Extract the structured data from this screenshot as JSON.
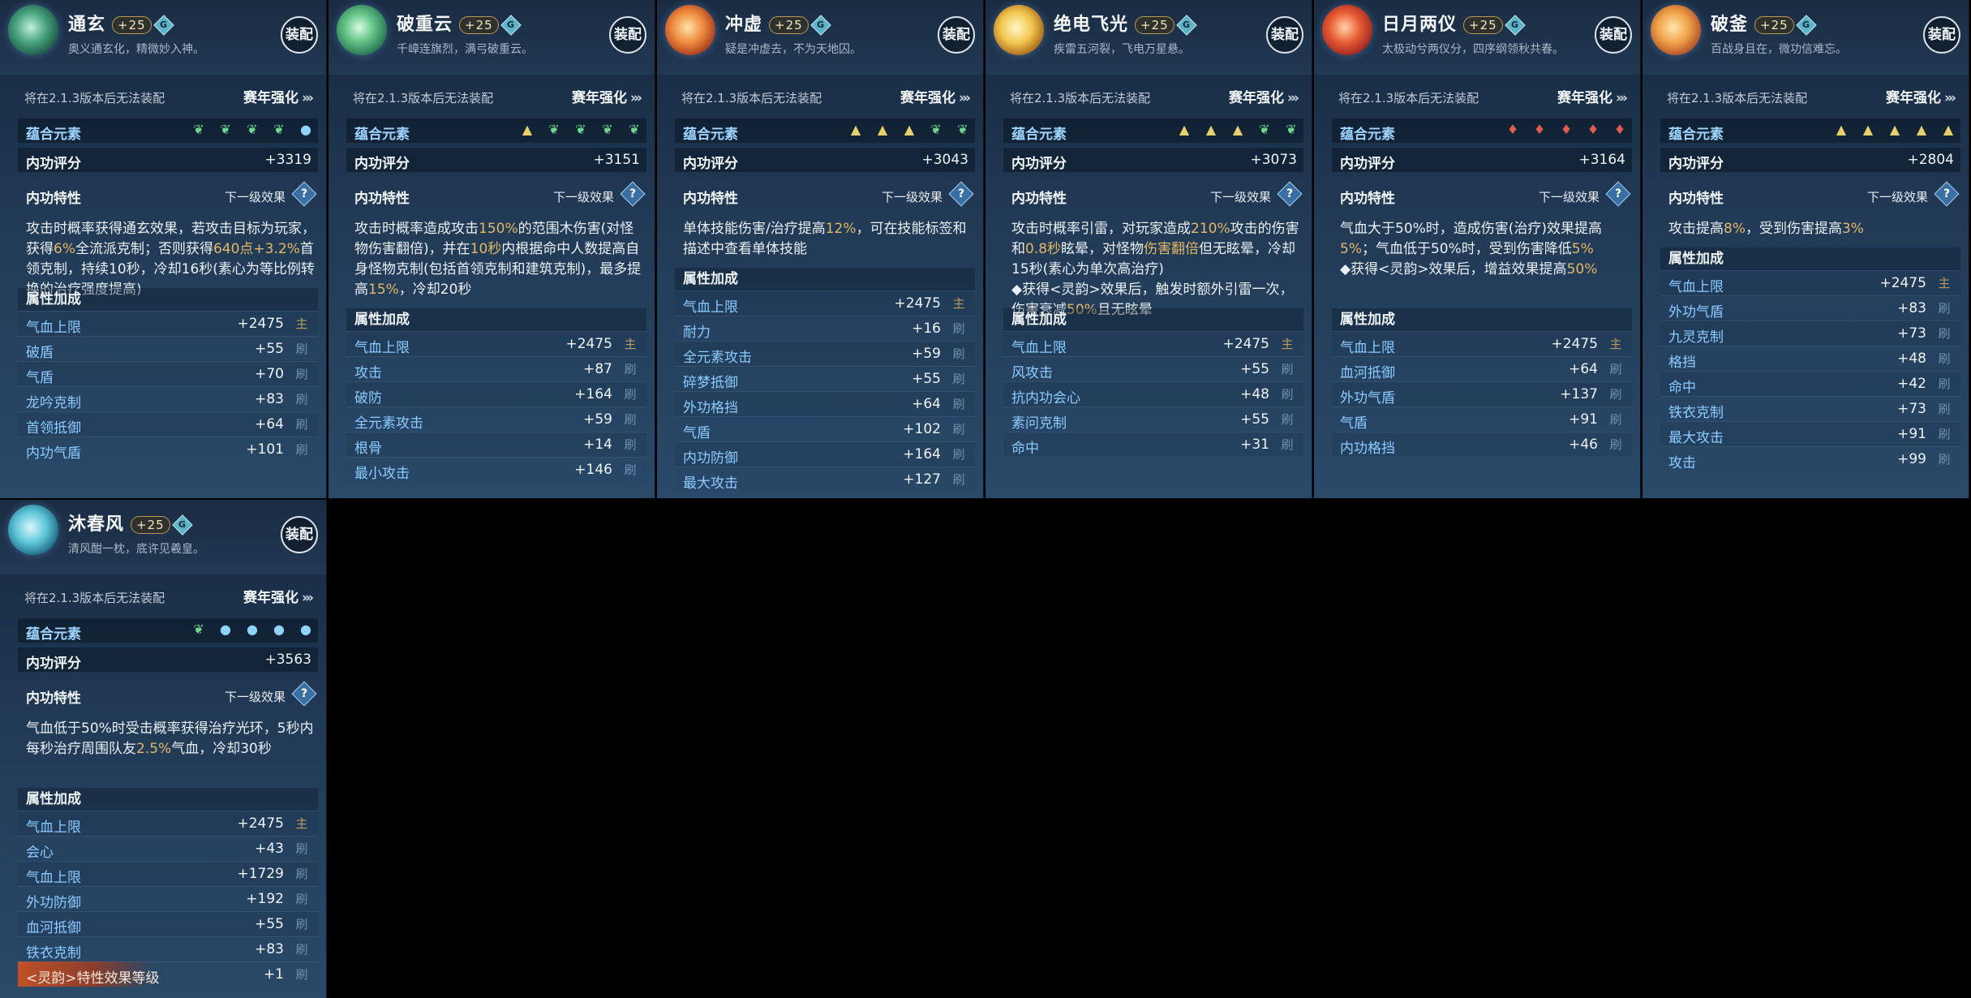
{
  "colors": {
    "highlight": "#e3b866",
    "attr_label": "#8ccbff",
    "panel_bg": "#213a56"
  },
  "cards": [
    {
      "name": "通玄",
      "level": "+25",
      "gem": "G",
      "motto": "奥义通玄化，精微妙入神。",
      "equip": "装配",
      "notice": "将在2.1.3版本后无法装配",
      "season": "赛年强化",
      "elements_label": "蕴合元素",
      "elements": [
        "leaf",
        "leaf",
        "leaf",
        "leaf",
        "drop"
      ],
      "score_label": "内功评分",
      "score": "+3319",
      "trait_label": "内功特性",
      "next_label": "下一级效果",
      "trait_segments": [
        {
          "t": "攻击时概率获得通玄效果，若攻击目标为玩家，获得"
        },
        {
          "t": "6%",
          "hl": true
        },
        {
          "t": "全流派克制；否则获得"
        },
        {
          "t": "640点+3.2%",
          "hl": true
        },
        {
          "t": "首领克制，持续10秒，冷却16秒(素心为等比例转换的治疗强度提高)"
        }
      ],
      "attr_title": "属性加成",
      "attrs": [
        {
          "label": "气血上限",
          "value": "+2475",
          "icon": "main"
        },
        {
          "label": "破盾",
          "value": "+55"
        },
        {
          "label": "气盾",
          "value": "+70"
        },
        {
          "label": "龙吟克制",
          "value": "+83"
        },
        {
          "label": "首领抵御",
          "value": "+64"
        },
        {
          "label": "内功气盾",
          "value": "+101"
        }
      ]
    },
    {
      "name": "破重云",
      "level": "+25",
      "gem": "G",
      "motto": "千嶂连旗烈，满弓破重云。",
      "equip": "装配",
      "notice": "将在2.1.3版本后无法装配",
      "season": "赛年强化",
      "elements_label": "蕴合元素",
      "elements": [
        "tri",
        "leaf",
        "leaf",
        "leaf",
        "leaf"
      ],
      "score_label": "内功评分",
      "score": "+3151",
      "trait_label": "内功特性",
      "next_label": "下一级效果",
      "trait_segments": [
        {
          "t": "攻击时概率造成攻击"
        },
        {
          "t": "150%",
          "hl": true
        },
        {
          "t": "的范围木伤害(对怪物伤害翻倍)，并在"
        },
        {
          "t": "10秒",
          "hl": true
        },
        {
          "t": "内根据命中人数提高自身怪物克制(包括首领克制和建筑克制)，最多提高"
        },
        {
          "t": "15%",
          "hl": true
        },
        {
          "t": "，冷却20秒"
        }
      ],
      "attr_title": "属性加成",
      "attrs": [
        {
          "label": "气血上限",
          "value": "+2475",
          "icon": "main"
        },
        {
          "label": "攻击",
          "value": "+87"
        },
        {
          "label": "破防",
          "value": "+164"
        },
        {
          "label": "全元素攻击",
          "value": "+59"
        },
        {
          "label": "根骨",
          "value": "+14"
        },
        {
          "label": "最小攻击",
          "value": "+146"
        }
      ]
    },
    {
      "name": "冲虚",
      "level": "+25",
      "gem": "G",
      "motto": "疑是冲虚去，不为天地囚。",
      "equip": "装配",
      "notice": "将在2.1.3版本后无法装配",
      "season": "赛年强化",
      "elements_label": "蕴合元素",
      "elements": [
        "tri",
        "tri",
        "tri",
        "leaf",
        "leaf"
      ],
      "score_label": "内功评分",
      "score": "+3043",
      "trait_label": "内功特性",
      "next_label": "下一级效果",
      "trait_segments": [
        {
          "t": "单体技能伤害/治疗提高"
        },
        {
          "t": "12%",
          "hl": true
        },
        {
          "t": "，可在技能标签和描述中查看单体技能"
        }
      ],
      "attr_title": "属性加成",
      "attrs": [
        {
          "label": "气血上限",
          "value": "+2475",
          "icon": "main"
        },
        {
          "label": "耐力",
          "value": "+16"
        },
        {
          "label": "全元素攻击",
          "value": "+59"
        },
        {
          "label": "碎梦抵御",
          "value": "+55"
        },
        {
          "label": "外功格挡",
          "value": "+64"
        },
        {
          "label": "气盾",
          "value": "+102"
        },
        {
          "label": "内功防御",
          "value": "+164"
        },
        {
          "label": "最大攻击",
          "value": "+127"
        }
      ]
    },
    {
      "name": "绝电飞光",
      "level": "+25",
      "gem": "G",
      "motto": "疾雷五河裂，飞电万星悬。",
      "equip": "装配",
      "notice": "将在2.1.3版本后无法装配",
      "season": "赛年强化",
      "elements_label": "蕴合元素",
      "elements": [
        "tri",
        "tri",
        "tri",
        "leaf",
        "leaf"
      ],
      "score_label": "内功评分",
      "score": "+3073",
      "trait_label": "内功特性",
      "next_label": "下一级效果",
      "trait_segments": [
        {
          "t": "攻击时概率引雷，对玩家造成"
        },
        {
          "t": "210%",
          "hl": true
        },
        {
          "t": "攻击的伤害和"
        },
        {
          "t": "0.8秒",
          "hl": true
        },
        {
          "t": "眩晕，对怪物"
        },
        {
          "t": "伤害翻倍",
          "hl": true
        },
        {
          "t": "但无眩晕，冷却15秒(素心为单次高治疗)\n◆获得<灵韵>效果后，触发时额外引雷一次，伤害衰减"
        },
        {
          "t": "50%",
          "hl": true
        },
        {
          "t": "且无眩晕"
        }
      ],
      "attr_title": "属性加成",
      "attrs": [
        {
          "label": "气血上限",
          "value": "+2475",
          "icon": "main"
        },
        {
          "label": "风攻击",
          "value": "+55"
        },
        {
          "label": "抗内功会心",
          "value": "+48"
        },
        {
          "label": "素问克制",
          "value": "+55"
        },
        {
          "label": "命中",
          "value": "+31"
        }
      ]
    },
    {
      "name": "日月两仪",
      "level": "+25",
      "gem": "G",
      "motto": "太极动兮两仪分，四序纲领秋共春。",
      "equip": "装配",
      "notice": "将在2.1.3版本后无法装配",
      "season": "赛年强化",
      "elements_label": "蕴合元素",
      "elements": [
        "fire",
        "fire",
        "fire",
        "fire",
        "fire"
      ],
      "score_label": "内功评分",
      "score": "+3164",
      "trait_label": "内功特性",
      "next_label": "下一级效果",
      "trait_segments": [
        {
          "t": "气血大于50%时，造成伤害(治疗)效果提高"
        },
        {
          "t": "5%",
          "hl": true
        },
        {
          "t": "；气血低于50%时，受到伤害降低"
        },
        {
          "t": "5%",
          "hl": true
        },
        {
          "t": "\n◆获得<灵韵>效果后，增益效果提高"
        },
        {
          "t": "50%",
          "hl": true
        }
      ],
      "attr_title": "属性加成",
      "attrs": [
        {
          "label": "气血上限",
          "value": "+2475",
          "icon": "main"
        },
        {
          "label": "血河抵御",
          "value": "+64"
        },
        {
          "label": "外功气盾",
          "value": "+137"
        },
        {
          "label": "气盾",
          "value": "+91"
        },
        {
          "label": "内功格挡",
          "value": "+46"
        }
      ]
    },
    {
      "name": "破釜",
      "level": "+25",
      "gem": "G",
      "motto": "百战身且在，微功信难忘。",
      "equip": "装配",
      "notice": "将在2.1.3版本后无法装配",
      "season": "赛年强化",
      "elements_label": "蕴合元素",
      "elements": [
        "tri",
        "tri",
        "tri",
        "tri",
        "tri"
      ],
      "score_label": "内功评分",
      "score": "+2804",
      "trait_label": "内功特性",
      "next_label": "下一级效果",
      "trait_segments": [
        {
          "t": "攻击提高"
        },
        {
          "t": "8%",
          "hl": true
        },
        {
          "t": "，受到伤害提高"
        },
        {
          "t": "3%",
          "hl": true
        }
      ],
      "attr_title": "属性加成",
      "attrs": [
        {
          "label": "气血上限",
          "value": "+2475",
          "icon": "main"
        },
        {
          "label": "外功气盾",
          "value": "+83"
        },
        {
          "label": "九灵克制",
          "value": "+73"
        },
        {
          "label": "格挡",
          "value": "+48"
        },
        {
          "label": "命中",
          "value": "+42"
        },
        {
          "label": "铁衣克制",
          "value": "+73"
        },
        {
          "label": "最大攻击",
          "value": "+91"
        },
        {
          "label": "攻击",
          "value": "+99"
        }
      ]
    },
    {
      "name": "沐春风",
      "level": "+25",
      "gem": "G",
      "motto": "清风酣一枕，底许见羲皇。",
      "equip": "装配",
      "notice": "将在2.1.3版本后无法装配",
      "season": "赛年强化",
      "elements_label": "蕴合元素",
      "elements": [
        "leaf",
        "drop",
        "drop",
        "drop",
        "drop"
      ],
      "score_label": "内功评分",
      "score": "+3563",
      "trait_label": "内功特性",
      "next_label": "下一级效果",
      "trait_segments": [
        {
          "t": "气血低于50%时受击概率获得治疗光环，5秒内每秒治疗周围队友"
        },
        {
          "t": "2.5%",
          "hl": true
        },
        {
          "t": "气血，冷却30秒"
        }
      ],
      "attr_title": "属性加成",
      "attrs": [
        {
          "label": "气血上限",
          "value": "+2475",
          "icon": "main"
        },
        {
          "label": "会心",
          "value": "+43"
        },
        {
          "label": "气血上限",
          "value": "+1729"
        },
        {
          "label": "外功防御",
          "value": "+192"
        },
        {
          "label": "血河抵御",
          "value": "+55"
        },
        {
          "label": "铁衣克制",
          "value": "+83"
        },
        {
          "label": "<灵韵>特性效果等级",
          "value": "+1",
          "special": true
        }
      ]
    }
  ]
}
